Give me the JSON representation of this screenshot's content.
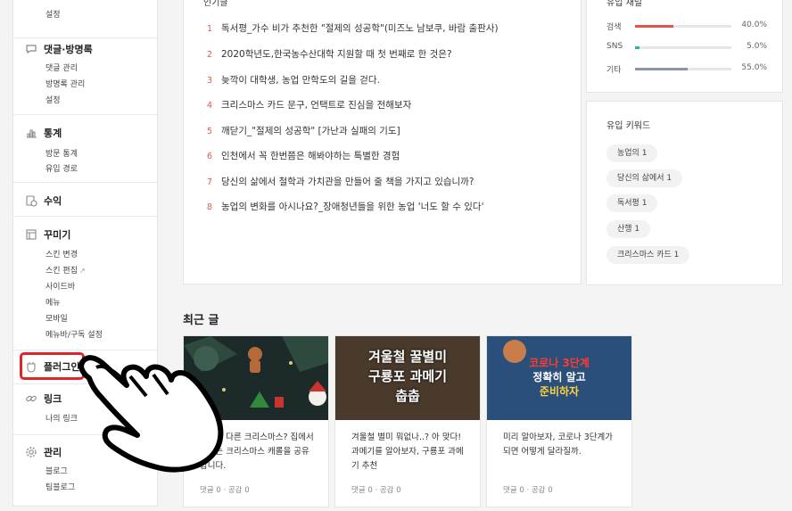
{
  "sidebar": {
    "top_item": "설정",
    "comments": {
      "title": "댓글·방명록",
      "items": [
        "댓글 관리",
        "방명록 관리",
        "설정"
      ]
    },
    "stats": {
      "title": "통계",
      "items": [
        "방문 통계",
        "유입 경로"
      ]
    },
    "revenue": {
      "title": "수익"
    },
    "design": {
      "title": "꾸미기",
      "items": [
        "스킨 변경",
        "스킨 편집",
        "사이드바",
        "메뉴",
        "모바일",
        "메뉴바/구독 설정"
      ]
    },
    "plugin": {
      "title": "플러그인"
    },
    "link": {
      "title": "링크",
      "items": [
        "나의 링크"
      ]
    },
    "manage": {
      "title": "관리",
      "items": [
        "블로그",
        "팀블로그"
      ]
    }
  },
  "popular": {
    "title": "인기글",
    "items": [
      {
        "rank": "1",
        "title": "독서평_가수 비가 추천한 \"절제의 성공학\"(미즈노 남보쿠, 바람 출판사)"
      },
      {
        "rank": "2",
        "title": "2020학년도,한국농수산대학 지원할 때 첫 번째로 한 것은?"
      },
      {
        "rank": "3",
        "title": "늦깍이 대학생, 농업 만학도의 길을 걷다."
      },
      {
        "rank": "4",
        "title": "크리스마스 카드 문구, 언택트로 진심을 전해보자"
      },
      {
        "rank": "5",
        "title": "깨닫기_\"절제의 성공학\" [가난과 실패의 기도]"
      },
      {
        "rank": "6",
        "title": "인천에서 꼭 한번쯤은 해봐야하는 특별한 경험"
      },
      {
        "rank": "7",
        "title": "당신의 삶에서 철학과 가치관을 만들어 줄 책을 가지고 있습니까?"
      },
      {
        "rank": "8",
        "title": "농업의 변화를 아시나요?_장애청년들을 위한 농업 '너도 할 수 있다'"
      }
    ]
  },
  "channels": {
    "title": "유입 채널",
    "rows": [
      {
        "label": "검색",
        "percent": "40.0%",
        "value": 0.4,
        "color": "#e8534a"
      },
      {
        "label": "SNS",
        "percent": "5.0%",
        "value": 0.05,
        "color": "#2bb5a3"
      },
      {
        "label": "기타",
        "percent": "55.0%",
        "value": 0.55,
        "color": "#8a96a8"
      }
    ]
  },
  "keywords": {
    "title": "유입 키워드",
    "items": [
      "농업의  1",
      "당신의 삶에서  1",
      "독서평  1",
      "산행  1",
      "크리스마스 카드  1"
    ]
  },
  "recent": {
    "title": "최근 글",
    "cards": [
      {
        "title": "작년과 다른 크리스마스? 집에서 즐기는 크리스마스 캐롤을 공유합니다.",
        "meta": "댓글 0 · 공감 0"
      },
      {
        "title": "겨울철 별미 뭐없나..? 아 맞다! 과메기를 알아보자, 구룡포 과메기 추천",
        "meta": "댓글 0 · 공감 0",
        "thumb_text": [
          "겨울철 꿀별미",
          "구룡포 과메기",
          "춥춥"
        ]
      },
      {
        "title": "미리 알아보자, 코로나 3단계가 되면 어떻게 달라질까.",
        "meta": "댓글 0 · 공감 0",
        "thumb_text": [
          "코로나 3단계",
          "정확히 알고",
          "준비하자"
        ]
      }
    ]
  },
  "colors": {
    "accent": "#e05a4a",
    "highlight": "#e3232b"
  }
}
